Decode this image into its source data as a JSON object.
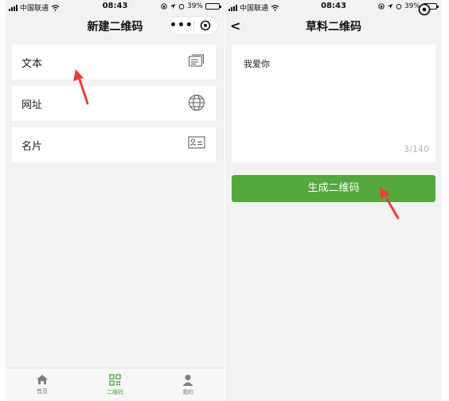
{
  "left": {
    "status": {
      "carrier": "中国联通",
      "time": "08:43",
      "battery": "39%",
      "battery_level": 0.39
    },
    "title": "新建二维码",
    "capsule": {
      "more": "•••"
    },
    "menu": [
      {
        "label": "文本",
        "icon": "text-card-icon"
      },
      {
        "label": "网址",
        "icon": "globe-icon"
      },
      {
        "label": "名片",
        "icon": "business-card-icon"
      }
    ],
    "tabs": [
      {
        "label": "首页",
        "icon": "home-icon"
      },
      {
        "label": "二维码",
        "icon": "qr-code-icon",
        "active": true
      },
      {
        "label": "我的",
        "icon": "user-icon"
      }
    ]
  },
  "right": {
    "status": {
      "carrier": "中国联通",
      "time": "08:43",
      "battery": "39%",
      "battery_level": 0.39
    },
    "title": "草料二维码",
    "back": "<",
    "text_content": "我爱你",
    "char_count": "3/140",
    "generate_button": "生成二维码"
  },
  "colors": {
    "accent": "#53a93c",
    "annotation_arrow": "#e8403c",
    "background": "#f2f2f2"
  }
}
